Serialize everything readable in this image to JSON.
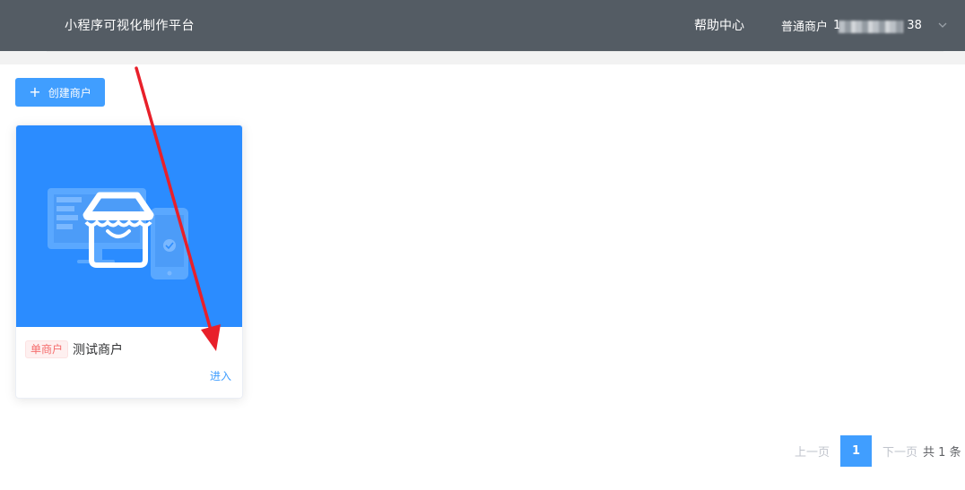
{
  "header": {
    "app_title": "小程序可视化制作平台",
    "help_label": "帮助中心",
    "user_role": "普通商户",
    "user_phone_prefix": "1",
    "user_phone_suffix": "38"
  },
  "toolbar": {
    "create_label": "创建商户"
  },
  "merchant_card": {
    "tag": "单商户",
    "name": "测试商户",
    "enter_label": "进入"
  },
  "pagination": {
    "prev_label": "上一页",
    "current_page": "1",
    "next_label": "下一页",
    "total_label": "共 1 条"
  },
  "colors": {
    "header_bg": "#545c64",
    "primary": "#409eff",
    "card_image_bg": "#2b8cff",
    "tag_red": "#f56c6c",
    "annotation_arrow": "#e8202a"
  },
  "icons": [
    "plus-icon",
    "chevron-down-icon",
    "store-illustration"
  ]
}
